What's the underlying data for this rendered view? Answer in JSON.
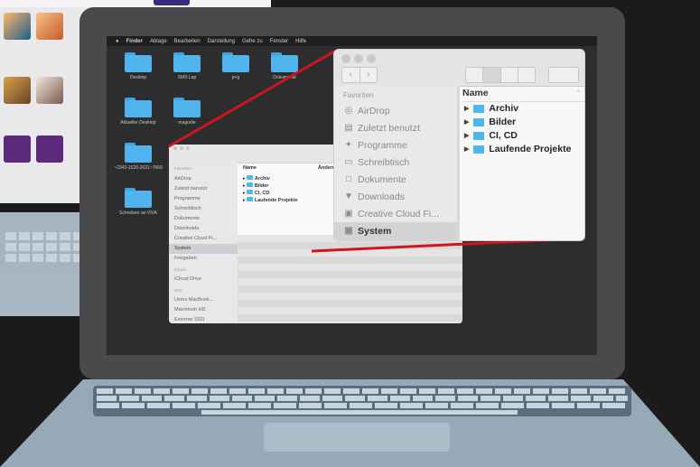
{
  "menubar": {
    "apple": "",
    "items": [
      "Finder",
      "Ablage",
      "Bearbeiten",
      "Darstellung",
      "Gehe zu",
      "Fenster",
      "Hilfe"
    ]
  },
  "desktop": {
    "icons": [
      "Desktop",
      "SMS Lap",
      "p+g",
      "Dokumente",
      "Aktueller Desktop",
      "magodie",
      "~2343-1626-2631~7669",
      "Schreiben an VIVA"
    ]
  },
  "small_window": {
    "sidebar": {
      "header_favorites": "Favoriten",
      "items": [
        "AirDrop",
        "Zuletzt benutzt",
        "Programme",
        "Schreibtisch",
        "Dokumente",
        "Downloads",
        "Creative Cloud Fi...",
        "System",
        "Freigaben"
      ],
      "header_icloud": "iCloud",
      "icloud_items": [
        "iCloud Drive"
      ],
      "header_places": "Orte",
      "place_items": [
        "Users MacBook...",
        "Macintosh HD",
        "Extreme SSD"
      ]
    },
    "column_header": "Name",
    "column_header_2": "Änderungsdatum",
    "rows": [
      "Archiv",
      "Bilder",
      "CI, CD",
      "Laufende Projekte"
    ]
  },
  "zoom_window": {
    "sidebar_header": "Favoriten",
    "sidebar_items": [
      {
        "label": "AirDrop",
        "icon": "airdrop-icon"
      },
      {
        "label": "Zuletzt benutzt",
        "icon": "clock-icon"
      },
      {
        "label": "Programme",
        "icon": "apps-icon"
      },
      {
        "label": "Schreibtisch",
        "icon": "desktop-icon"
      },
      {
        "label": "Dokumente",
        "icon": "document-icon"
      },
      {
        "label": "Downloads",
        "icon": "download-icon"
      },
      {
        "label": "Creative Cloud Fi...",
        "icon": "folder-icon"
      },
      {
        "label": "System",
        "icon": "folder-icon"
      }
    ],
    "column_header": "Name",
    "rows": [
      "Archiv",
      "Bilder",
      "CI, CD",
      "Laufende Projekte"
    ]
  },
  "colors": {
    "highlight_line": "#d0161d",
    "folder_blue": "#4fb5ec",
    "selected_row": "#d3d3d6"
  }
}
